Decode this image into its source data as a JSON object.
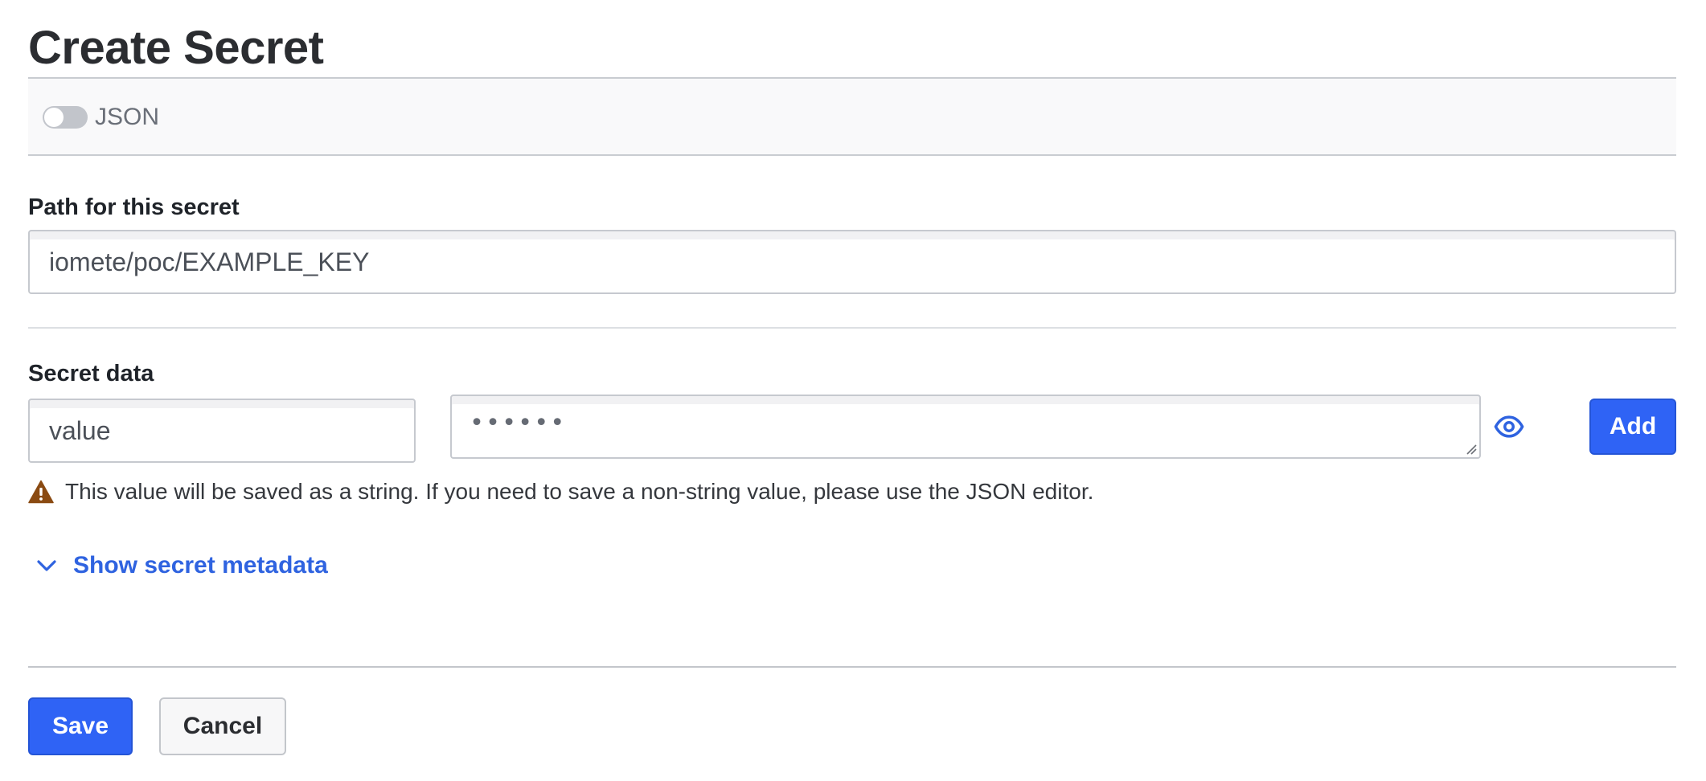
{
  "page": {
    "title": "Create Secret"
  },
  "toolbar": {
    "json_toggle_label": "JSON",
    "json_toggle_on": false
  },
  "path_field": {
    "label": "Path for this secret",
    "value": "iomete/poc/EXAMPLE_KEY"
  },
  "secret_data": {
    "label": "Secret data",
    "key_value": "value",
    "masked_value": "••••••",
    "add_label": "Add",
    "warning": "This value will be saved as a string. If you need to save a non-string value, please use the JSON editor."
  },
  "metadata": {
    "toggle_label": "Show secret metadata"
  },
  "actions": {
    "save_label": "Save",
    "cancel_label": "Cancel"
  },
  "colors": {
    "primary": "#2f63f5",
    "link": "#2f63e0",
    "warning": "#8a4a12",
    "toggle_off": "#c2c5cb"
  },
  "icons": {
    "eye": "eye-icon",
    "warning": "warning-icon",
    "chevron": "chevron-down-icon"
  }
}
